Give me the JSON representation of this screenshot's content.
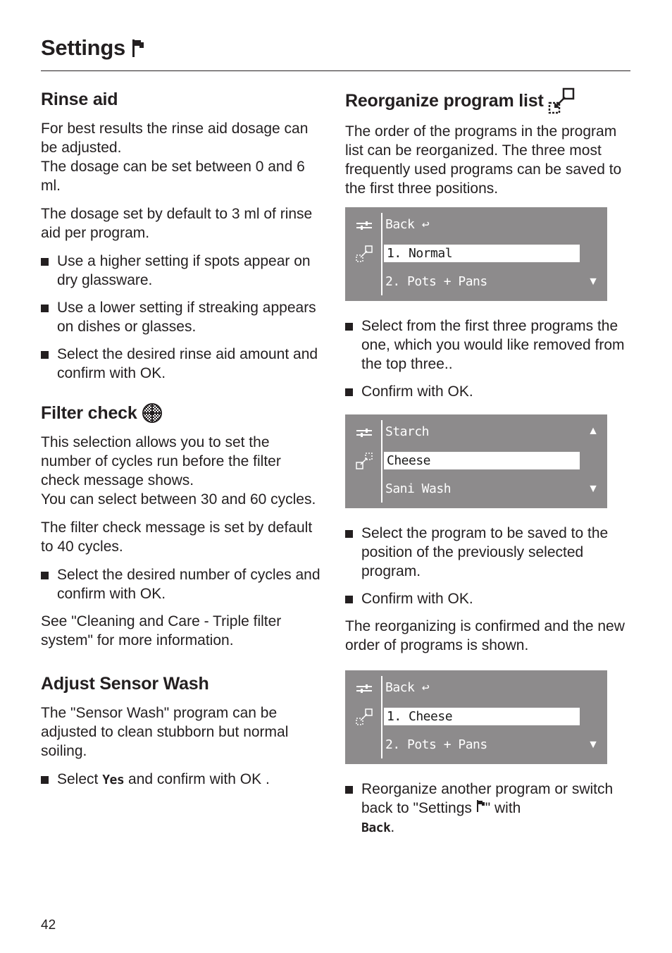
{
  "page": {
    "title": "Settings",
    "title_icon": "flag-icon",
    "number": "42"
  },
  "left": {
    "rinse_aid": {
      "heading": "Rinse aid",
      "paragraphs": [
        "For best results the rinse aid dosage can be adjusted. The dosage can be set between 0 and 6 ml.",
        "The dosage set by default to 3 ml of rinse aid per program."
      ],
      "p1a": "For best results the rinse aid dosage can be adjusted.",
      "p1b": "The dosage can be set between 0 and 6 ml.",
      "p2": "The dosage set by default to 3 ml of rinse aid per program.",
      "bullets": [
        "Use a higher setting if spots appear on dry glassware.",
        "Use a lower setting if streaking appears on dishes or glasses.",
        "Select the desired rinse aid amount and confirm with OK."
      ]
    },
    "filter_check": {
      "heading": "Filter check",
      "heading_icon": "filter-icon",
      "p1a": "This selection allows you to set the number of cycles run before the filter check message shows.",
      "p1b": "You can select between 30 and 60 cycles.",
      "p2": "The filter check message is set by default to 40 cycles.",
      "bullets": [
        "Select the desired number of cycles and confirm with OK."
      ],
      "p3": "See \"Cleaning and Care - Triple filter system\" for more information."
    },
    "sensor_wash": {
      "heading": "Adjust Sensor Wash",
      "p1": "The \"Sensor Wash\" program can be adjusted to clean stubborn but normal soiling.",
      "bullet_pre": "Select ",
      "bullet_lcd": "Yes",
      "bullet_post": " and confirm with OK ."
    }
  },
  "right": {
    "reorganize": {
      "heading": "Reorganize program list",
      "heading_icon": "reorganize-icon",
      "p1": "The order of the programs in the program list can be reorganized. The three most frequently used programs can be saved to the first three positions.",
      "display1": {
        "row1": "Back",
        "row1_icon": "return-arrow-icon",
        "selected": "1. Normal",
        "row3": "2. Pots + Pans",
        "scroll_down": "▼"
      },
      "bullets1": [
        "Select from the first three programs the one, which you would like removed from the top three..",
        "Confirm with OK."
      ],
      "display2": {
        "row1": "Starch",
        "selected": "Cheese",
        "row3": "Sani Wash",
        "scroll_up": "▲",
        "scroll_down": "▼"
      },
      "bullets2": [
        "Select the program to be saved to the position of the previously selected program.",
        "Confirm with OK."
      ],
      "p2": "The reorganizing is confirmed and the new order of programs is shown.",
      "display3": {
        "row1": "Back",
        "row1_icon": "return-arrow-icon",
        "selected": "1. Cheese",
        "row3": "2. Pots + Pans",
        "scroll_down": "▼"
      },
      "final_bullet_a": "Reorganize another program or switch back to \"Settings ",
      "final_bullet_b": "\" with ",
      "final_bullet_lcd": "Back",
      "final_bullet_c": "."
    }
  }
}
